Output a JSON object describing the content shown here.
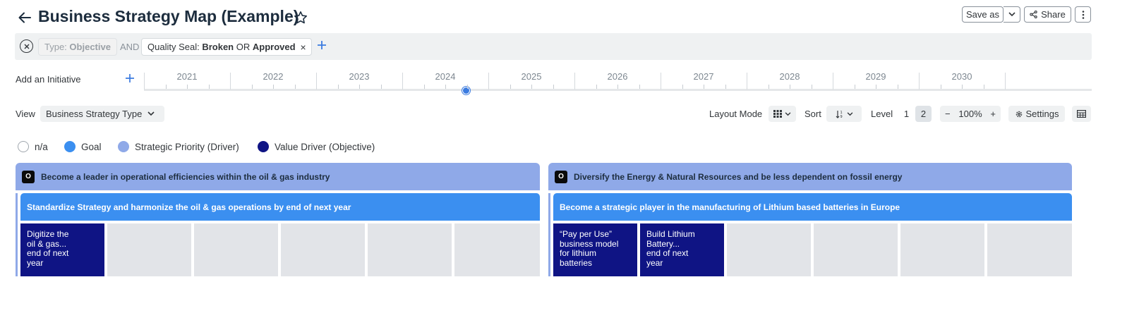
{
  "header": {
    "title": "Business Strategy Map (Example)",
    "save_as_label": "Save as",
    "share_label": "Share"
  },
  "filters": {
    "chip_type": {
      "key": "Type:",
      "value": "Objective"
    },
    "and_label": "AND",
    "chip_quality": {
      "key": "Quality Seal:",
      "value1": "Broken",
      "or_label": "OR",
      "value2": "Approved",
      "remove_glyph": "×"
    }
  },
  "timeline": {
    "add_initiative_label": "Add an Initiative",
    "years": [
      "2021",
      "2022",
      "2023",
      "2024",
      "2025",
      "2026",
      "2027",
      "2028",
      "2029",
      "2030"
    ]
  },
  "toolbar": {
    "view_label": "View",
    "view_value": "Business Strategy Type",
    "layout_mode_label": "Layout Mode",
    "sort_label": "Sort",
    "level_label": "Level",
    "levels": [
      "1",
      "2"
    ],
    "selected_level": "2",
    "zoom_minus": "−",
    "zoom_value": "100%",
    "zoom_plus": "+",
    "settings_label": "Settings"
  },
  "legend": [
    {
      "label": "n/a",
      "color": "#ffffff"
    },
    {
      "label": "Goal",
      "color": "#3b8ff0"
    },
    {
      "label": "Strategic Priority (Driver)",
      "color": "#8fa9e8"
    },
    {
      "label": "Value Driver (Objective)",
      "color": "#0f1484"
    }
  ],
  "map": {
    "columns": [
      {
        "objective_badge": "O",
        "objective": "Become a leader in operational efficiencies within the oil & gas industry",
        "goal": "Standardize Strategy and harmonize the oil & gas operations by end of next year",
        "drivers": [
          {
            "lines": [
              "Digitize the",
              "oil & gas...",
              "end of next",
              "year"
            ]
          }
        ]
      },
      {
        "objective_badge": "O",
        "objective": "Diversify the Energy & Natural Resources and be less dependent on fossil energy",
        "goal": "Become a strategic player in the manufacturing of Lithium based batteries in Europe",
        "drivers": [
          {
            "lines": [
              "“Pay per Use”",
              "business model",
              "for lithium",
              "batteries"
            ]
          },
          {
            "lines": [
              "Build Lithium",
              "Battery...",
              "end of next",
              "year"
            ]
          }
        ]
      }
    ]
  },
  "colors": {
    "accent": "#3b7be0",
    "objective_bg": "#8fa9e8",
    "goal_bg": "#3b8ff0",
    "driver_bg": "#0f1484",
    "empty_cell": "#e2e4e8"
  }
}
